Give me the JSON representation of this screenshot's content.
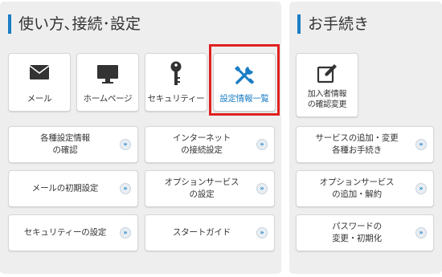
{
  "left_panel": {
    "title": "使い方､接続･設定",
    "tiles": [
      {
        "label": "メール",
        "icon": "envelope-icon"
      },
      {
        "label": "ホームページ",
        "icon": "monitor-icon"
      },
      {
        "label": "セキュリティー",
        "icon": "key-icon"
      },
      {
        "label": "設定情報一覧",
        "icon": "tools-icon"
      }
    ],
    "buttons": [
      {
        "label": "各種設定情報\nの確認"
      },
      {
        "label": "インターネット\nの接続設定"
      },
      {
        "label": "メールの初期設定"
      },
      {
        "label": "オプションサービス\nの設定"
      },
      {
        "label": "セキュリティーの設定"
      },
      {
        "label": "スタートガイド"
      }
    ]
  },
  "right_panel": {
    "title": "お手続き",
    "tile": {
      "label": "加入者情報\nの確認変更",
      "icon": "edit-icon"
    },
    "buttons": [
      {
        "label": "サービスの追加・変更\n各種お手続き"
      },
      {
        "label": "オプションサービス\nの追加・解約"
      },
      {
        "label": "パスワードの\n変更・初期化"
      }
    ]
  },
  "arrow_glyph": "»",
  "colors": {
    "accent": "#1a7dc4",
    "highlight": "#e02020",
    "panel_bg": "#eeeeee"
  }
}
